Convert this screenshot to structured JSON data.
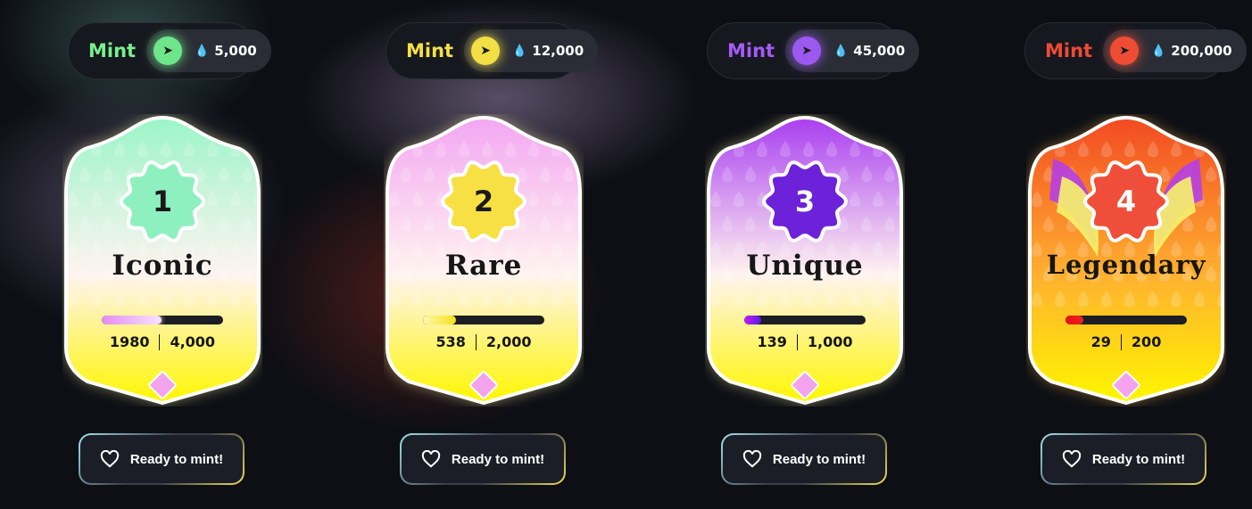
{
  "tiers": [
    {
      "mint_label": "Mint",
      "accent": "#78f08c",
      "coin_color": "#6ee58a",
      "coin_icon": "mint-arrow-icon",
      "price": "5,000",
      "number": "1",
      "name": "Iconic",
      "minted": "1980",
      "supply": "4,000",
      "progress": 0.495,
      "card_top": "#9af5c8",
      "badge_color": "#8ef0bf",
      "number_color": "#1a1a1a",
      "fill_gradient": [
        "#e58bf0",
        "#f7e3ff"
      ],
      "button_label": "Ready to mint!"
    },
    {
      "mint_label": "Mint",
      "accent": "#f5df45",
      "coin_color": "#f2de45",
      "coin_icon": "mint-arrow-icon",
      "price": "12,000",
      "number": "2",
      "name": "Rare",
      "minted": "538",
      "supply": "2,000",
      "progress": 0.269,
      "card_top": "#f3a6f2",
      "badge_color": "#f7e043",
      "number_color": "#1a1a1a",
      "fill_gradient": [
        "#fff6b0",
        "#f5e21c"
      ],
      "button_label": "Ready to mint!"
    },
    {
      "mint_label": "Mint",
      "accent": "#a55bf5",
      "coin_color": "#9b59f0",
      "coin_icon": "mint-arrow-icon",
      "price": "45,000",
      "number": "3",
      "name": "Unique",
      "minted": "139",
      "supply": "1,000",
      "progress": 0.139,
      "card_top": "#a93ef0",
      "badge_color": "#6c22d8",
      "number_color": "#ffffff",
      "fill_gradient": [
        "#c01cf0",
        "#5a1ee0"
      ],
      "button_label": "Ready to mint!"
    },
    {
      "mint_label": "Mint",
      "accent": "#ef4a35",
      "coin_color": "#ee4d34",
      "coin_icon": "mint-arrow-icon",
      "price": "200,000",
      "number": "4",
      "name": "Legendary",
      "minted": "29",
      "supply": "200",
      "progress": 0.145,
      "card_top": "#f24a22",
      "badge_color": "#ef4f3a",
      "number_color": "#ffffff",
      "fill_gradient": [
        "#e81010",
        "#f02020"
      ],
      "button_label": "Ready to mint!"
    }
  ]
}
